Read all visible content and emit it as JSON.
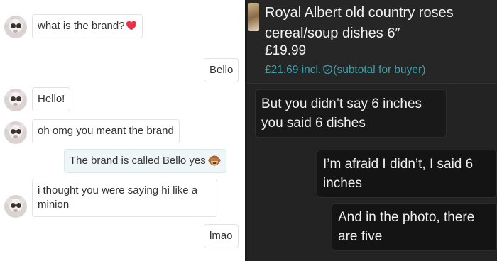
{
  "left_chat": {
    "messages": [
      {
        "from": "other",
        "text": "what is the brand?",
        "emoji": "heart-emoji"
      },
      {
        "from": "me",
        "text": "Bello"
      },
      {
        "from": "other",
        "text": "Hello!"
      },
      {
        "from": "other",
        "text": "oh omg you meant the brand"
      },
      {
        "from": "me",
        "text": "The brand is called Bello yes",
        "emoji": "see-no-evil-monkey-emoji"
      },
      {
        "from": "other",
        "text": "i thought you were saying hi like a minion"
      },
      {
        "from": "me",
        "text": "lmao"
      }
    ]
  },
  "right_chat": {
    "product": {
      "title": "Royal Albert old country roses cereal/soup dishes 6″",
      "price": "£19.99",
      "incl_price": "£21.69 incl.",
      "incl_note": "(subtotal for buyer)"
    },
    "messages": [
      {
        "from": "other",
        "text": "But you didn’t say 6 inches you said 6 dishes"
      },
      {
        "from": "me",
        "text": "I’m afraid I didn’t, I said 6 inches"
      },
      {
        "from": "me",
        "text": "And in the photo, there are five"
      }
    ]
  },
  "colors": {
    "left_bg": "#ffffff",
    "right_bg": "#232323",
    "accent_teal": "#3f9fa8",
    "heart_red": "#e8334a"
  }
}
